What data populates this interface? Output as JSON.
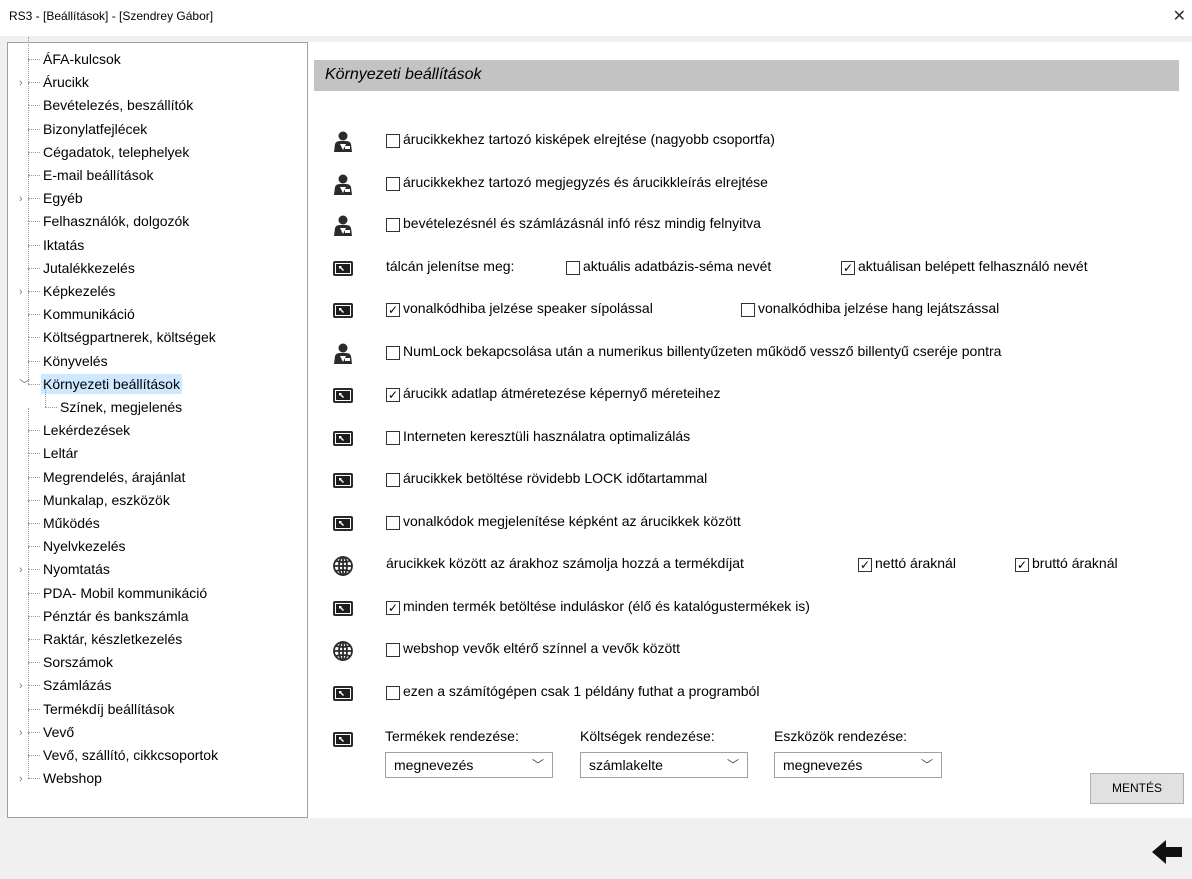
{
  "window": {
    "title": "RS3 - [Beállítások] - [Szendrey Gábor]",
    "close_glyph": "✕"
  },
  "tree": {
    "items": [
      {
        "label": "ÁFA-kulcsok",
        "expandable": false
      },
      {
        "label": "Árucikk",
        "expandable": true
      },
      {
        "label": "Bevételezés, beszállítók",
        "expandable": false
      },
      {
        "label": "Bizonylatfejlécek",
        "expandable": false
      },
      {
        "label": "Cégadatok, telephelyek",
        "expandable": false
      },
      {
        "label": "E-mail beállítások",
        "expandable": false
      },
      {
        "label": "Egyéb",
        "expandable": true
      },
      {
        "label": "Felhasználók, dolgozók",
        "expandable": false
      },
      {
        "label": "Iktatás",
        "expandable": false
      },
      {
        "label": "Jutalékkezelés",
        "expandable": false
      },
      {
        "label": "Képkezelés",
        "expandable": true
      },
      {
        "label": "Kommunikáció",
        "expandable": false
      },
      {
        "label": "Költségpartnerek, költségek",
        "expandable": false
      },
      {
        "label": "Könyvelés",
        "expandable": false
      },
      {
        "label": "Környezeti beállítások",
        "expandable": true,
        "expanded": true,
        "selected": true
      },
      {
        "label": "Színek, megjelenés",
        "child": true
      },
      {
        "label": "Lekérdezések",
        "expandable": false
      },
      {
        "label": "Leltár",
        "expandable": false
      },
      {
        "label": "Megrendelés, árajánlat",
        "expandable": false
      },
      {
        "label": "Munkalap, eszközök",
        "expandable": false
      },
      {
        "label": "Működés",
        "expandable": false
      },
      {
        "label": "Nyelvkezelés",
        "expandable": false
      },
      {
        "label": "Nyomtatás",
        "expandable": true
      },
      {
        "label": "PDA- Mobil kommunikáció",
        "expandable": false
      },
      {
        "label": "Pénztár és bankszámla",
        "expandable": false
      },
      {
        "label": "Raktár, készletkezelés",
        "expandable": false
      },
      {
        "label": "Sorszámok",
        "expandable": false
      },
      {
        "label": "Számlázás",
        "expandable": true
      },
      {
        "label": "Termékdíj beállítások",
        "expandable": false
      },
      {
        "label": "Vevő",
        "expandable": true
      },
      {
        "label": "Vevő, szállító, cikkcsoportok",
        "expandable": false
      },
      {
        "label": "Webshop",
        "expandable": true
      }
    ]
  },
  "panel": {
    "title": "Környezeti beállítások",
    "rows": [
      {
        "icon": "user-icon",
        "items": [
          {
            "checked": false,
            "label": "árucikkekhez tartozó kisképek elrejtése (nagyobb csoportfa)"
          }
        ]
      },
      {
        "icon": "user-icon",
        "items": [
          {
            "checked": false,
            "label": "árucikkekhez tartozó megjegyzés és árucikkleírás elrejtése"
          }
        ]
      },
      {
        "icon": "user-icon",
        "items": [
          {
            "checked": false,
            "label": "bevételezésnél és számlázásnál infó rész mindig felnyitva"
          }
        ]
      },
      {
        "icon": "monitor-icon",
        "prefix": "tálcán jelenítse meg:",
        "items": [
          {
            "checked": false,
            "label": "aktuális adatbázis-séma nevét"
          },
          {
            "checked": true,
            "label": "aktuálisan belépett felhasználó nevét"
          }
        ]
      },
      {
        "icon": "monitor-icon",
        "items": [
          {
            "checked": true,
            "label": "vonalkódhiba jelzése speaker sípolással"
          },
          {
            "checked": false,
            "label": "vonalkódhiba jelzése hang lejátszással"
          }
        ]
      },
      {
        "icon": "user-icon",
        "items": [
          {
            "checked": false,
            "label": "NumLock bekapcsolása után a numerikus billentyűzeten működő vessző billentyű cseréje pontra"
          }
        ]
      },
      {
        "icon": "monitor-icon",
        "items": [
          {
            "checked": true,
            "label": "árucikk adatlap átméretezése képernyő méreteihez"
          }
        ]
      },
      {
        "icon": "monitor-icon",
        "items": [
          {
            "checked": false,
            "label": "Interneten keresztüli használatra optimalizálás"
          }
        ]
      },
      {
        "icon": "monitor-icon",
        "items": [
          {
            "checked": false,
            "label": "árucikkek betöltése rövidebb LOCK időtartammal"
          }
        ]
      },
      {
        "icon": "monitor-icon",
        "items": [
          {
            "checked": false,
            "label": "vonalkódok megjelenítése képként az árucikkek között"
          }
        ]
      },
      {
        "icon": "globe-icon",
        "prefix": "árucikkek között az árakhoz számolja hozzá a termékdíjat",
        "items": [
          {
            "checked": true,
            "label": "nettó áraknál"
          },
          {
            "checked": true,
            "label": "bruttó áraknál"
          }
        ]
      },
      {
        "icon": "monitor-icon",
        "items": [
          {
            "checked": true,
            "label": "minden termék betöltése induláskor (élő és katalógustermékek is)"
          }
        ]
      },
      {
        "icon": "globe-icon",
        "items": [
          {
            "checked": false,
            "label": "webshop vevők eltérő színnel a vevők között"
          }
        ]
      },
      {
        "icon": "monitor-icon",
        "items": [
          {
            "checked": false,
            "label": "ezen a számítógépen csak 1 példány futhat a programból"
          }
        ]
      }
    ],
    "sort": {
      "products_label": "Termékek rendezése:",
      "products_value": "megnevezés",
      "costs_label": "Költségek rendezése:",
      "costs_value": "számlakelte",
      "assets_label": "Eszközök rendezése:",
      "assets_value": "megnevezés"
    },
    "save_label": "MENTÉS"
  },
  "colors": {
    "selected_bg": "#cde8ff",
    "header_bg": "#c3c3c3"
  }
}
